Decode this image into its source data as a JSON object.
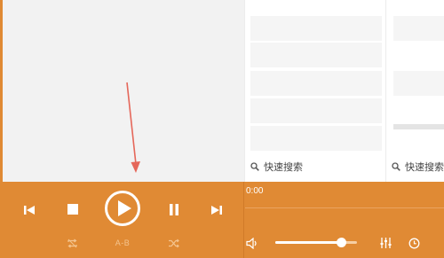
{
  "player": {
    "current_time": "0:00",
    "ab_label": "A-B",
    "volume_level": 0.8
  },
  "panels": [
    {
      "search_placeholder": "快速搜索"
    },
    {
      "search_placeholder": "快速搜索"
    }
  ],
  "icons": {
    "prev": "skip-previous-icon",
    "stop": "stop-icon",
    "play": "play-circle-icon",
    "pause": "pause-icon",
    "next": "skip-next-icon",
    "repeat": "repeat-icon",
    "shuffle": "shuffle-icon",
    "volume": "volume-icon",
    "equalizer": "equalizer-icon",
    "timer": "timer-icon",
    "search": "search-icon"
  },
  "colors": {
    "accent": "#e08a34",
    "annotation": "#e5675a"
  }
}
